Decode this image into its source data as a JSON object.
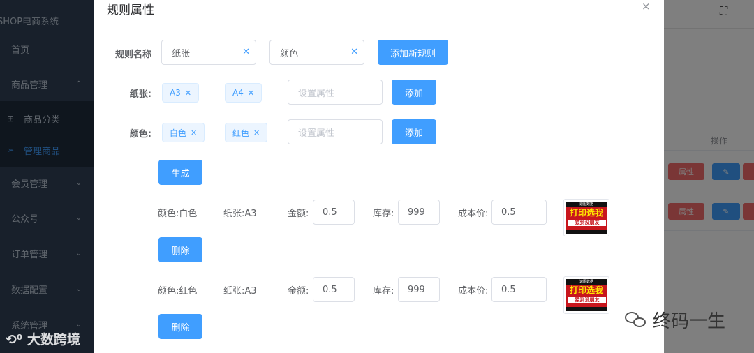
{
  "sidebar": {
    "brand": "SHOP电商系统",
    "items": [
      {
        "label": "首页",
        "chevron": ""
      },
      {
        "label": "商品管理",
        "chevron": "⌃"
      },
      {
        "label": "商品分类",
        "chevron": ""
      },
      {
        "label": "管理商品",
        "chevron": ""
      },
      {
        "label": "会员管理",
        "chevron": "⌄"
      },
      {
        "label": "公众号",
        "chevron": "⌄"
      },
      {
        "label": "订单管理",
        "chevron": "⌄"
      },
      {
        "label": "数据配置",
        "chevron": "⌄"
      },
      {
        "label": "系统管理",
        "chevron": "⌄"
      }
    ]
  },
  "background": {
    "column_header": "操作",
    "row_buttons": [
      {
        "attr_label": "属性",
        "edit_icon": "✎"
      },
      {
        "attr_label": "属性",
        "edit_icon": "✎"
      }
    ]
  },
  "dialog": {
    "title": "规则属性",
    "close": "×",
    "rule_label": "规则名称",
    "rule_names": [
      "纸张",
      "颜色"
    ],
    "add_rule_button": "添加新规则",
    "attribute_groups": [
      {
        "label": "纸张:",
        "tags": [
          "A3",
          "A4"
        ],
        "placeholder": "设置属性",
        "add_button": "添加"
      },
      {
        "label": "颜色:",
        "tags": [
          "白色",
          "红色"
        ],
        "placeholder": "设置属性",
        "add_button": "添加"
      }
    ],
    "generate_button": "生成",
    "sku_rows": [
      {
        "color": "颜色:白色",
        "paper": "纸张:A3",
        "price_label": "金额:",
        "price": "0.5",
        "stock_label": "库存:",
        "stock": "999",
        "cost_label": "成本价:",
        "cost": "0.5",
        "delete_button": "删除"
      },
      {
        "color": "颜色:红色",
        "paper": "纸张:A3",
        "price_label": "金额:",
        "price": "0.5",
        "stock_label": "库存:",
        "stock": "999",
        "cost_label": "成本价:",
        "cost": "0.5",
        "delete_button": "删除"
      }
    ],
    "thumbnail": {
      "top": "速图数据",
      "main": "打印选我",
      "sub": "猿到没朋友"
    }
  },
  "watermarks": {
    "left": "大数跨境",
    "right": "终码一生"
  },
  "colors": {
    "primary": "#409eff",
    "danger": "#f56c6c",
    "sidebar": "#304156"
  }
}
